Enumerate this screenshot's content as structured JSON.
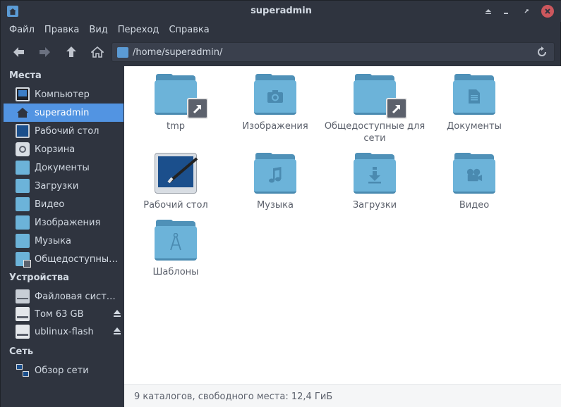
{
  "window": {
    "title": "superadmin"
  },
  "menu": [
    "Файл",
    "Правка",
    "Вид",
    "Переход",
    "Справка"
  ],
  "location": {
    "path": "/home/superadmin/"
  },
  "sidebar": {
    "places_header": "Места",
    "places": [
      {
        "label": "Компьютер",
        "icon": "computer-icon"
      },
      {
        "label": "superadmin",
        "icon": "home-icon",
        "active": true
      },
      {
        "label": "Рабочий стол",
        "icon": "desktop-icon"
      },
      {
        "label": "Корзина",
        "icon": "trash-icon"
      },
      {
        "label": "Документы",
        "icon": "documents-folder-icon"
      },
      {
        "label": "Загрузки",
        "icon": "downloads-folder-icon"
      },
      {
        "label": "Видео",
        "icon": "video-folder-icon"
      },
      {
        "label": "Изображения",
        "icon": "pictures-folder-icon"
      },
      {
        "label": "Музыка",
        "icon": "music-folder-icon"
      },
      {
        "label": "Общедоступные ...",
        "icon": "public-folder-icon"
      }
    ],
    "devices_header": "Устройства",
    "devices": [
      {
        "label": "Файловая система",
        "icon": "drive-icon"
      },
      {
        "label": "Том 63 GB",
        "icon": "usb-drive-icon"
      },
      {
        "label": "ublinux-flash",
        "icon": "usb-drive-icon"
      }
    ],
    "network_header": "Сеть",
    "network": [
      {
        "label": "Обзор сети",
        "icon": "network-icon"
      }
    ]
  },
  "items": [
    {
      "label": "tmp",
      "icon": "folder-link-icon"
    },
    {
      "label": "Изображения",
      "icon": "pictures-folder-icon"
    },
    {
      "label": "Общедоступные для сети",
      "icon": "public-folder-icon"
    },
    {
      "label": "Документы",
      "icon": "documents-folder-icon"
    },
    {
      "label": "Рабочий стол",
      "icon": "desktop-icon"
    },
    {
      "label": "Музыка",
      "icon": "music-folder-icon"
    },
    {
      "label": "Загрузки",
      "icon": "downloads-folder-icon"
    },
    {
      "label": "Видео",
      "icon": "video-folder-icon"
    },
    {
      "label": "Шаблоны",
      "icon": "templates-folder-icon"
    }
  ],
  "status": {
    "text": "9 каталогов, свободного места: 12,4 ГиБ"
  },
  "colors": {
    "accent": "#5294e2",
    "folder": "#6cb3d9",
    "folder_dark": "#4f91b8",
    "close": "#cc575d"
  }
}
